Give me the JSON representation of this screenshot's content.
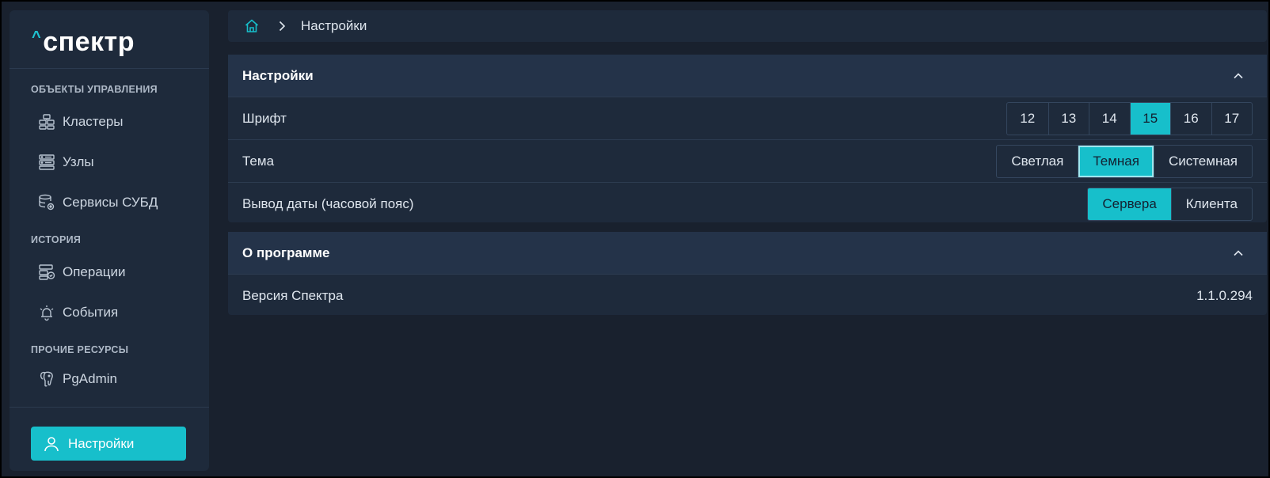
{
  "brand": {
    "logo_text": "спектр",
    "logo_caret": "^",
    "accent": "#17bfcb"
  },
  "sidebar": {
    "sections": [
      {
        "title": "ОБЪЕКТЫ УПРАВЛЕНИЯ",
        "items": [
          {
            "label": "Кластеры",
            "icon": "cluster-icon"
          },
          {
            "label": "Узлы",
            "icon": "server-icon"
          },
          {
            "label": "Сервисы СУБД",
            "icon": "database-gear-icon"
          }
        ]
      },
      {
        "title": "ИСТОРИЯ",
        "items": [
          {
            "label": "Операции",
            "icon": "operations-icon"
          },
          {
            "label": "События",
            "icon": "alarm-bell-icon"
          }
        ]
      },
      {
        "title": "ПРОЧИЕ РЕСУРСЫ",
        "items": [
          {
            "label": "PgAdmin",
            "icon": "postgres-elephant-icon"
          }
        ]
      }
    ],
    "settings_button": {
      "label": "Настройки",
      "icon": "user-icon"
    }
  },
  "breadcrumb": {
    "current": "Настройки"
  },
  "settings_panel": {
    "title": "Настройки",
    "font": {
      "label": "Шрифт",
      "options": [
        "12",
        "13",
        "14",
        "15",
        "16",
        "17"
      ],
      "selected": "15"
    },
    "theme": {
      "label": "Тема",
      "options": [
        "Светлая",
        "Темная",
        "Системная"
      ],
      "selected": "Темная"
    },
    "timezone": {
      "label": "Вывод даты (часовой пояс)",
      "options": [
        "Сервера",
        "Клиента"
      ],
      "selected": "Сервера"
    }
  },
  "about_panel": {
    "title": "О программе",
    "version_label": "Версия Спектра",
    "version_value": "1.1.0.294"
  }
}
